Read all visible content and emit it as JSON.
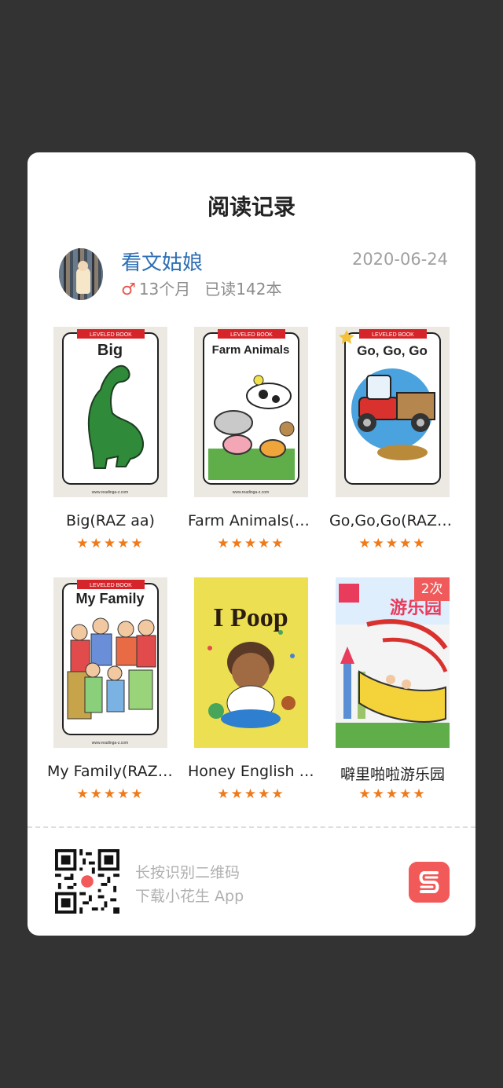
{
  "card": {
    "title": "阅读记录",
    "user": {
      "name": "看文姑娘",
      "gender_symbol": "♂",
      "age": "13个月",
      "read_count": "已读142本"
    },
    "date": "2020-06-24"
  },
  "books": [
    {
      "title": "Big(RAZ aa)",
      "rating": 5,
      "cover_word": "Big",
      "cover_series": "LEVELED BOOK",
      "cover_site": "www.readinga-z.com",
      "cover_color": "#f7f7f3"
    },
    {
      "title": "Farm Animals(RAZ aa)",
      "rating": 5,
      "cover_word": "Farm Animals",
      "cover_series": "LEVELED BOOK",
      "cover_site": "www.readinga-z.com",
      "cover_color": "#f7f7f3"
    },
    {
      "title": "Go,Go,Go(RAZ aa)",
      "rating": 5,
      "cover_word": "Go, Go, Go",
      "cover_series": "LEVELED BOOK",
      "cover_site": "",
      "cover_color": "#f7f7f3"
    },
    {
      "title": "My Family(RAZ aa)",
      "rating": 5,
      "cover_word": "My Family",
      "cover_series": "LEVELED BOOK",
      "cover_site": "www.readinga-z.com",
      "cover_color": "#f7f7f3"
    },
    {
      "title": "Honey English I Poop",
      "rating": 5,
      "cover_word": "I Poop",
      "cover_series": "",
      "cover_site": "",
      "cover_color": "#ecdf52"
    },
    {
      "title": "噼里啪啦游乐园",
      "rating": 5,
      "cover_word": "游乐园",
      "cover_series": "",
      "cover_site": "",
      "cover_color": "#f4f4f4",
      "badge": "2次"
    }
  ],
  "stars_text": "★★★★★",
  "footer": {
    "hint_line1": "长按识别二维码",
    "hint_line2": "下载小花生 App"
  },
  "colors": {
    "background": "#333333",
    "card": "#ffffff",
    "username": "#2f6fb5",
    "star": "#ef7a1a",
    "badge": "#f05a5a",
    "app_logo": "#f25a5a",
    "male": "#e9534c"
  }
}
